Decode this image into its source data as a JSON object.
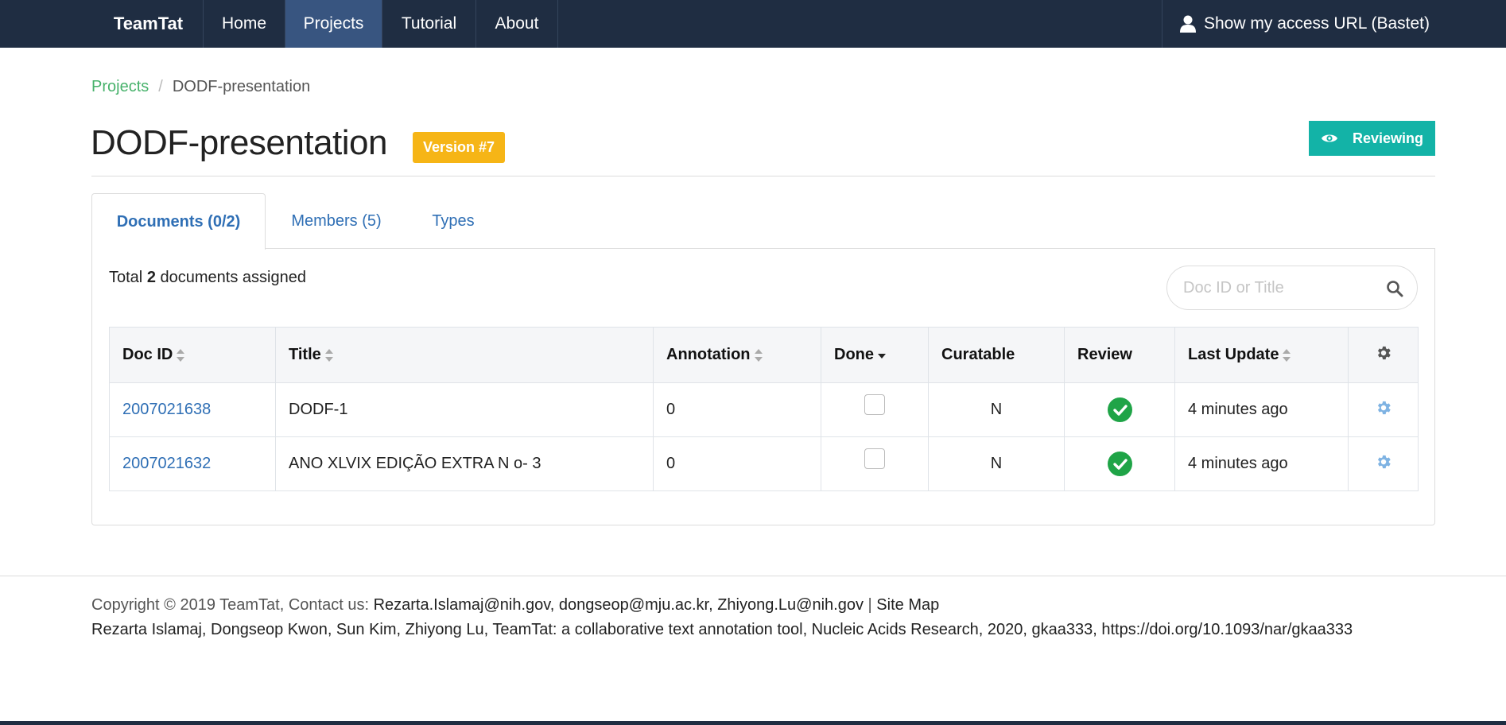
{
  "navbar": {
    "brand": "TeamTat",
    "items": [
      {
        "label": "Home",
        "active": false
      },
      {
        "label": "Projects",
        "active": true
      },
      {
        "label": "Tutorial",
        "active": false
      },
      {
        "label": "About",
        "active": false
      }
    ],
    "access_url": "Show my access URL (Bastet)",
    "access_icon": "user-icon"
  },
  "breadcrumb": {
    "link": "Projects",
    "separator": "/",
    "current": "DODF-presentation"
  },
  "project": {
    "title": "DODF-presentation",
    "version_badge": "Version #7",
    "reviewing_label": "Reviewing",
    "reviewing_icon": "eye-icon"
  },
  "tabs": [
    {
      "label": "Documents (0/2)",
      "active": true
    },
    {
      "label": "Members (5)",
      "active": false
    },
    {
      "label": "Types",
      "active": false
    }
  ],
  "documents": {
    "total_prefix": "Total",
    "total_count": "2",
    "total_suffix": "documents assigned",
    "search_placeholder": "Doc ID or Title",
    "columns": {
      "doc_id": "Doc ID",
      "title": "Title",
      "annotation": "Annotation",
      "done": "Done",
      "curatable": "Curatable",
      "review": "Review",
      "last_update": "Last Update"
    },
    "rows": [
      {
        "doc_id": "2007021638",
        "title": "DODF-1",
        "annotation": "0",
        "done": false,
        "curatable": "N",
        "review": true,
        "last_update": "4 minutes ago"
      },
      {
        "doc_id": "2007021632",
        "title": "ANO XLVIX EDIÇÃO EXTRA N o- 3",
        "annotation": "0",
        "done": false,
        "curatable": "N",
        "review": true,
        "last_update": "4 minutes ago"
      }
    ]
  },
  "footer": {
    "copyright": "Copyright © 2019 TeamTat, Contact us:",
    "contacts": "Rezarta.Islamaj@nih.gov, dongseop@mju.ac.kr, Zhiyong.Lu@nih.gov",
    "pipe": "|",
    "sitemap": "Site Map",
    "citation": "Rezarta Islamaj, Dongseop Kwon, Sun Kim, Zhiyong Lu, TeamTat: a collaborative text annotation tool, Nucleic Acids Research, 2020, gkaa333, https://doi.org/10.1093/nar/gkaa333"
  },
  "colors": {
    "navbar": "#1f2d42",
    "nav_active": "#385580",
    "badge": "#f6b516",
    "reviewing": "#13b3a7",
    "link": "#2f6fb5",
    "breadcrumb_link": "#47b26b",
    "check_green": "#1fa447"
  }
}
